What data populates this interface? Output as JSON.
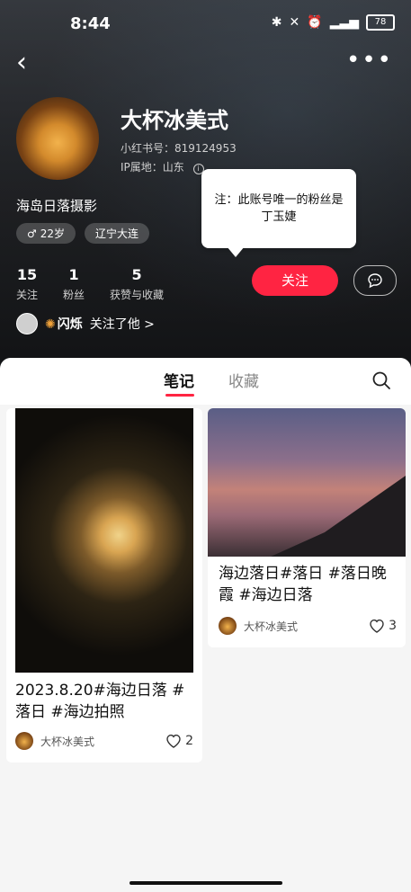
{
  "statusbar": {
    "time": "8:44",
    "battery": "78"
  },
  "topnav": {
    "back_icon": "chevron-left-icon",
    "more_icon": "more-dots-icon"
  },
  "profile": {
    "nickname": "大杯冰美式",
    "redbook_id": "小红书号：819124953",
    "ip": "IP属地：山东",
    "bio": "海岛日落摄影",
    "tags": [
      {
        "icon": "male-symbol-icon",
        "label": "22岁"
      },
      {
        "icon": "",
        "label": "辽宁大连"
      }
    ],
    "stats": [
      {
        "num": "15",
        "label": "关注"
      },
      {
        "num": "1",
        "label": "粉丝"
      },
      {
        "num": "5",
        "label": "获赞与收藏"
      }
    ],
    "follow_button": "关注",
    "followed_by": {
      "name": "闪烁",
      "suffix": "关注了他 >"
    }
  },
  "note_bubble": {
    "text": "注：此账号唯一的粉丝是丁玉婕"
  },
  "tabs": {
    "notes": "笔记",
    "favorites": "收藏"
  },
  "cards": [
    {
      "title": "2023.8.20#海边日落 #落日 #海边拍照",
      "user": "大杯冰美式",
      "likes": "2"
    },
    {
      "title": "海边落日#落日 #落日晚霞 #海边日落",
      "user": "大杯冰美式",
      "likes": "3"
    }
  ],
  "colors": {
    "accent": "#ff2442"
  }
}
